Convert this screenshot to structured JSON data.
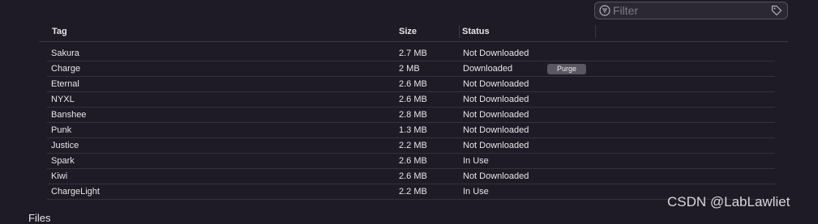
{
  "filter": {
    "placeholder": "Filter"
  },
  "table": {
    "headers": {
      "tag": "Tag",
      "size": "Size",
      "status": "Status"
    },
    "rows": [
      {
        "tag": "Sakura",
        "size": "2.7 MB",
        "status": "Not Downloaded"
      },
      {
        "tag": "Charge",
        "size": "2 MB",
        "status": "Downloaded",
        "action": "Purge"
      },
      {
        "tag": "Eternal",
        "size": "2.6 MB",
        "status": "Not Downloaded"
      },
      {
        "tag": "NYXL",
        "size": "2.6 MB",
        "status": "Not Downloaded"
      },
      {
        "tag": "Banshee",
        "size": "2.8 MB",
        "status": "Not Downloaded"
      },
      {
        "tag": "Punk",
        "size": "1.3 MB",
        "status": "Not Downloaded"
      },
      {
        "tag": "Justice",
        "size": "2.2 MB",
        "status": "Not Downloaded"
      },
      {
        "tag": "Spark",
        "size": "2.6 MB",
        "status": "In Use"
      },
      {
        "tag": "Kiwi",
        "size": "2.6 MB",
        "status": "Not Downloaded"
      },
      {
        "tag": "ChargeLight",
        "size": "2.2 MB",
        "status": "In Use"
      }
    ]
  },
  "next_section": {
    "label": "Files"
  },
  "watermark": "CSDN @LabLawliet",
  "icons": {
    "filter": "filter-icon",
    "tag": "tag-icon"
  },
  "colors": {
    "background": "#1f1b26",
    "purge_button": "#5a5762"
  }
}
